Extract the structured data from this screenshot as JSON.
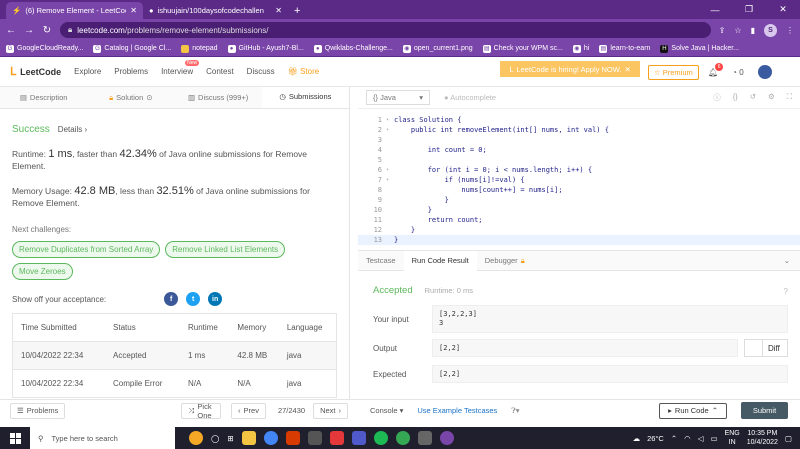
{
  "browser": {
    "tabs": [
      {
        "title": "(6) Remove Element - LeetCode",
        "active": true
      },
      {
        "title": "ishuujain/100daysofcodechallen",
        "active": false
      }
    ],
    "url_host": "leetcode.com",
    "url_path": "/problems/remove-element/submissions/",
    "profile_initial": "S",
    "bookmarks": [
      "GoogleCloudReady...",
      "Catalog | Google Cl...",
      "notepad",
      "GitHub - Ayush7-Bl...",
      "Qwiklabs-Challenge...",
      "open_current1.png",
      "Check your WPM sc...",
      "hi",
      "learn-to-earn",
      "Solve Java | Hacker..."
    ]
  },
  "header": {
    "logo": "LeetCode",
    "nav": [
      "Explore",
      "Problems",
      "Interview",
      "Contest",
      "Discuss",
      "Store"
    ],
    "new_badge": "New",
    "hiring": "LeetCode is hiring! Apply NOW.",
    "premium": "Premium",
    "notif_count": "6",
    "coins": "0"
  },
  "left_tabs": [
    "Description",
    "Solution",
    "Discuss (999+)",
    "Submissions"
  ],
  "result": {
    "status": "Success",
    "details": "Details",
    "runtime_prefix": "Runtime: ",
    "runtime_value": "1 ms",
    "runtime_mid": ", faster than ",
    "runtime_pct": "42.34%",
    "runtime_suffix": " of Java online submissions for Remove Element.",
    "memory_prefix": "Memory Usage: ",
    "memory_value": "42.8 MB",
    "memory_mid": ", less than ",
    "memory_pct": "32.51%",
    "memory_suffix": " of Java online submissions for Remove Element.",
    "next_label": "Next challenges:",
    "challenges": [
      "Remove Duplicates from Sorted Array",
      "Remove Linked List Elements",
      "Move Zeroes"
    ],
    "share_label": "Show off your acceptance:"
  },
  "submissions": {
    "headers": [
      "Time Submitted",
      "Status",
      "Runtime",
      "Memory",
      "Language"
    ],
    "rows": [
      [
        "10/04/2022 22:34",
        "Accepted",
        "1 ms",
        "42.8 MB",
        "java"
      ],
      [
        "10/04/2022 22:34",
        "Compile Error",
        "N/A",
        "N/A",
        "java"
      ]
    ]
  },
  "editor": {
    "language": "Java",
    "autocomplete": "Autocomplete",
    "lines": [
      "class Solution {",
      "    public int removeElement(int[] nums, int val) {",
      "",
      "        int count = 0;",
      "",
      "        for (int i = 0; i < nums.length; i++) {",
      "            if (nums[i]!=val) {",
      "                nums[count++] = nums[i];",
      "            }",
      "        }",
      "        return count;",
      "    }",
      "}"
    ]
  },
  "console": {
    "tabs": [
      "Testcase",
      "Run Code Result",
      "Debugger"
    ],
    "status": "Accepted",
    "runtime": "Runtime: 0 ms",
    "input_label": "Your input",
    "input_line1": "[3,2,2,3]",
    "input_line2": "3",
    "output_label": "Output",
    "output": "[2,2]",
    "diff_label": "Diff",
    "expected_label": "Expected",
    "expected": "[2,2]"
  },
  "footer": {
    "problems": "Problems",
    "pick_one": "Pick One",
    "prev": "Prev",
    "page": "27/2430",
    "next": "Next",
    "console": "Console",
    "example_testcases": "Use Example Testcases",
    "run_code": "Run Code",
    "submit": "Submit"
  },
  "taskbar": {
    "search_placeholder": "Type here to search",
    "temp": "26°C",
    "lang": "ENG",
    "region": "IN",
    "time": "10:35 PM",
    "date": "10/4/2022"
  }
}
